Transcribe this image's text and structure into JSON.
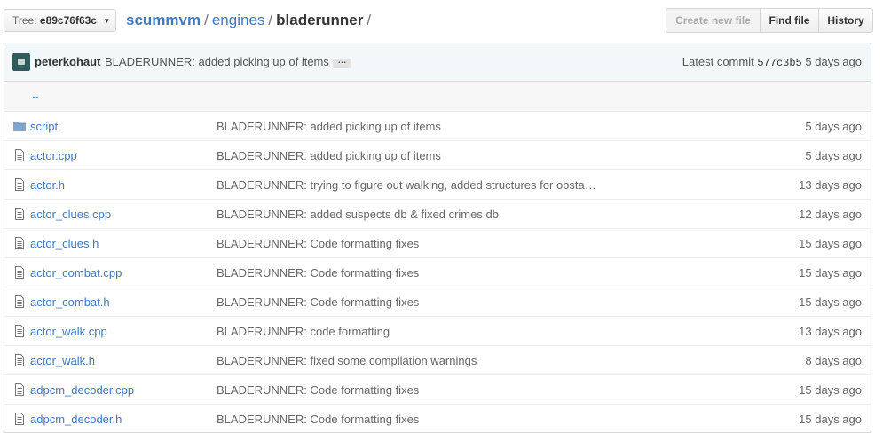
{
  "header": {
    "tree_prefix": "Tree:",
    "tree_value": "e89c76f63c",
    "breadcrumb": {
      "repo": "scummvm",
      "sep1": "/",
      "folder": "engines",
      "sep2": "/",
      "current": "bladerunner",
      "sep3": "/"
    },
    "buttons": {
      "create_new_file": "Create new file",
      "find_file": "Find file",
      "history": "History"
    }
  },
  "commit": {
    "author": "peterkohaut",
    "message": "BLADERUNNER: added picking up of items",
    "ellipsis": "…",
    "latest_label": "Latest commit",
    "sha": "577c3b5",
    "age": "5 days ago"
  },
  "parent_dir": "..",
  "files": [
    {
      "type": "folder-icon",
      "name": "script",
      "message": "BLADERUNNER: added picking up of items",
      "age": "5 days ago"
    },
    {
      "type": "file-icon",
      "name": "actor.cpp",
      "message": "BLADERUNNER: added picking up of items",
      "age": "5 days ago"
    },
    {
      "type": "file-icon",
      "name": "actor.h",
      "message": "BLADERUNNER: trying to figure out walking, added structures for obsta…",
      "age": "13 days ago"
    },
    {
      "type": "file-icon",
      "name": "actor_clues.cpp",
      "message": "BLADERUNNER: added suspects db & fixed crimes db",
      "age": "12 days ago"
    },
    {
      "type": "file-icon",
      "name": "actor_clues.h",
      "message": "BLADERUNNER: Code formatting fixes",
      "age": "15 days ago"
    },
    {
      "type": "file-icon",
      "name": "actor_combat.cpp",
      "message": "BLADERUNNER: Code formatting fixes",
      "age": "15 days ago"
    },
    {
      "type": "file-icon",
      "name": "actor_combat.h",
      "message": "BLADERUNNER: Code formatting fixes",
      "age": "15 days ago"
    },
    {
      "type": "file-icon",
      "name": "actor_walk.cpp",
      "message": "BLADERUNNER: code formatting",
      "age": "13 days ago"
    },
    {
      "type": "file-icon",
      "name": "actor_walk.h",
      "message": "BLADERUNNER: fixed some compilation warnings",
      "age": "8 days ago"
    },
    {
      "type": "file-icon",
      "name": "adpcm_decoder.cpp",
      "message": "BLADERUNNER: Code formatting fixes",
      "age": "15 days ago"
    },
    {
      "type": "file-icon",
      "name": "adpcm_decoder.h",
      "message": "BLADERUNNER: Code formatting fixes",
      "age": "15 days ago"
    }
  ],
  "colors": {
    "link": "#4078c0",
    "folder": "#80a6cd",
    "file": "#777777",
    "commit_bg": "#f2f8fa"
  }
}
